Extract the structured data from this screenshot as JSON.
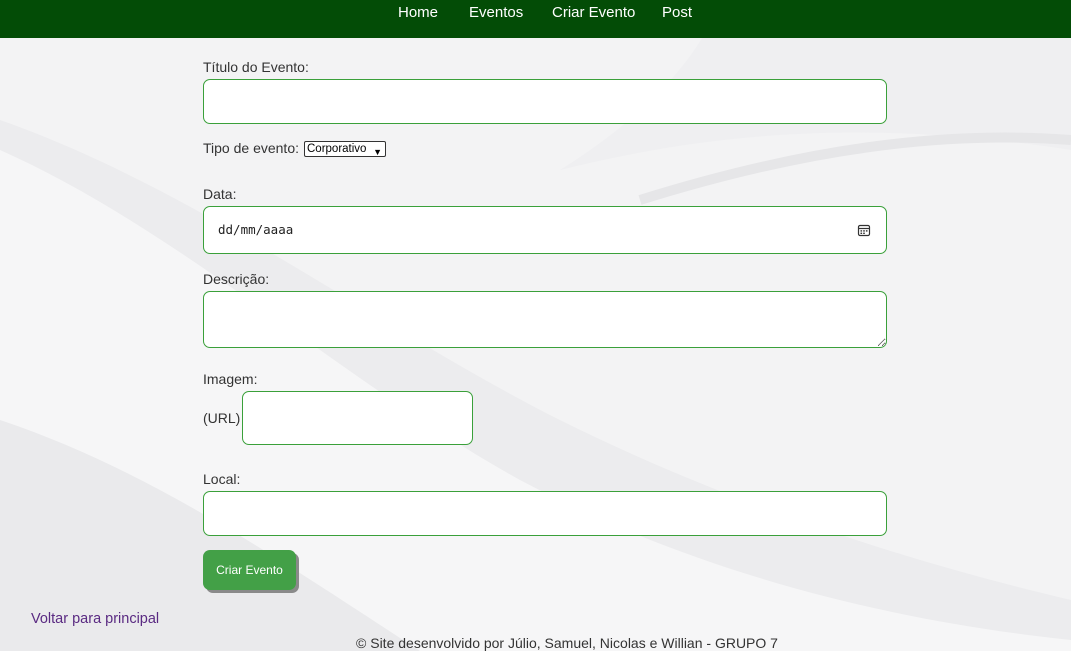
{
  "nav": {
    "items": [
      {
        "label": "Home"
      },
      {
        "label": "Eventos"
      },
      {
        "label": "Criar Evento"
      },
      {
        "label": "Post"
      }
    ]
  },
  "form": {
    "title_label": "Título do Evento:",
    "title_value": "",
    "type_label": "Tipo de evento:",
    "type_selected": "Corporativo",
    "date_label": "Data:",
    "date_placeholder": "dd/mm/aaaa",
    "description_label": "Descrição:",
    "description_value": "",
    "image_label": "Imagem:",
    "image_url_label": "(URL)",
    "image_url_value": "",
    "location_label": "Local:",
    "location_value": "",
    "submit_label": "Criar Evento"
  },
  "back_link": "Voltar para principal",
  "footer": "© Site desenvolvido por Júlio, Samuel, Nicolas e Willian - GRUPO 7",
  "colors": {
    "navbar": "#034c06",
    "input_border": "#3aa03a",
    "button": "#43a047",
    "link": "#5a2a82",
    "background": "#f4f4f5"
  },
  "icons": {
    "date_picker": "calendar-icon",
    "select_arrow": "chevron-down-icon"
  }
}
